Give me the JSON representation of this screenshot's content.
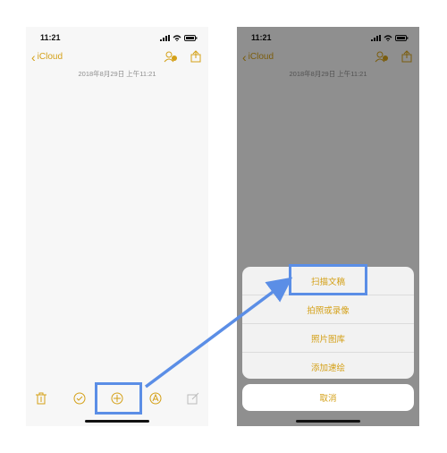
{
  "status": {
    "time": "11:21"
  },
  "navbar": {
    "back_label": "iCloud"
  },
  "note": {
    "date": "2018年8月29日 上午11:21"
  },
  "toolbar": {
    "icons": [
      "trash-icon",
      "checklist-icon",
      "add-icon",
      "markup-icon",
      "compose-icon"
    ]
  },
  "action_sheet": {
    "items": [
      "扫描文稿",
      "拍照或录像",
      "照片图库",
      "添加速绘"
    ],
    "cancel": "取消"
  },
  "colors": {
    "accent": "#d4a017",
    "highlight": "#5b8ee6",
    "dim_overlay": "#6b6b6b"
  }
}
